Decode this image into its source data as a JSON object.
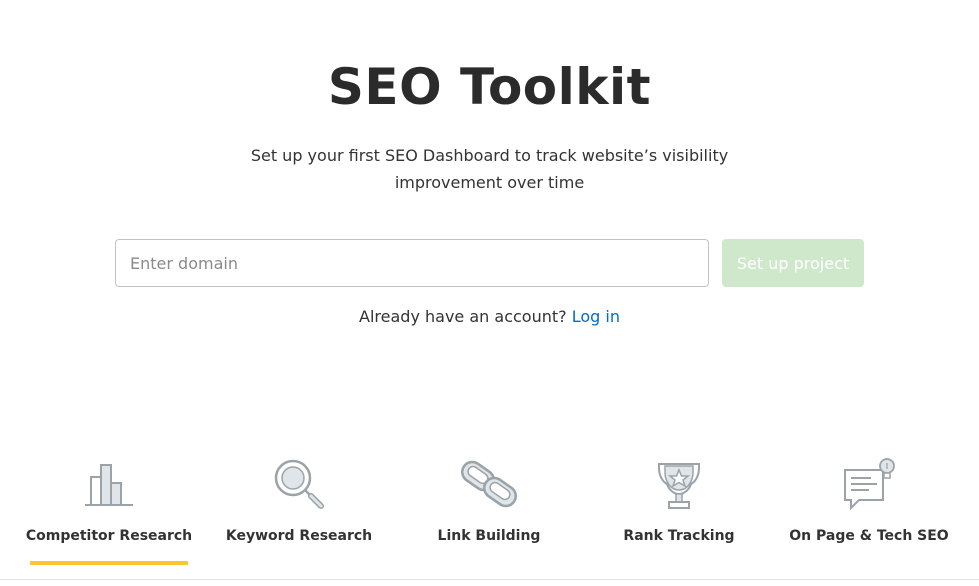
{
  "header": {
    "title": "SEO Toolkit",
    "subtitle_line1": "Set up your first SEO Dashboard to track website’s visibility",
    "subtitle_line2": "improvement over time"
  },
  "form": {
    "domain_placeholder": "Enter domain",
    "domain_value": "",
    "submit_label": "Set up project",
    "submit_color": "#cfe8cc"
  },
  "login": {
    "prompt": "Already have an account?",
    "link_label": "Log in",
    "link_color": "#006dca"
  },
  "tabs": [
    {
      "label": "Competitor Research",
      "icon": "bar-chart-icon",
      "active": true
    },
    {
      "label": "Keyword Research",
      "icon": "magnifier-icon",
      "active": false
    },
    {
      "label": "Link Building",
      "icon": "chain-link-icon",
      "active": false
    },
    {
      "label": "Rank Tracking",
      "icon": "trophy-icon",
      "active": false
    },
    {
      "label": "On Page & Tech SEO",
      "icon": "document-lightbulb-icon",
      "active": false
    }
  ],
  "colors": {
    "active_tab_underline": "#ffc52e",
    "icon_stroke": "#9ba3a8",
    "icon_fill": "#dfe5e8"
  }
}
